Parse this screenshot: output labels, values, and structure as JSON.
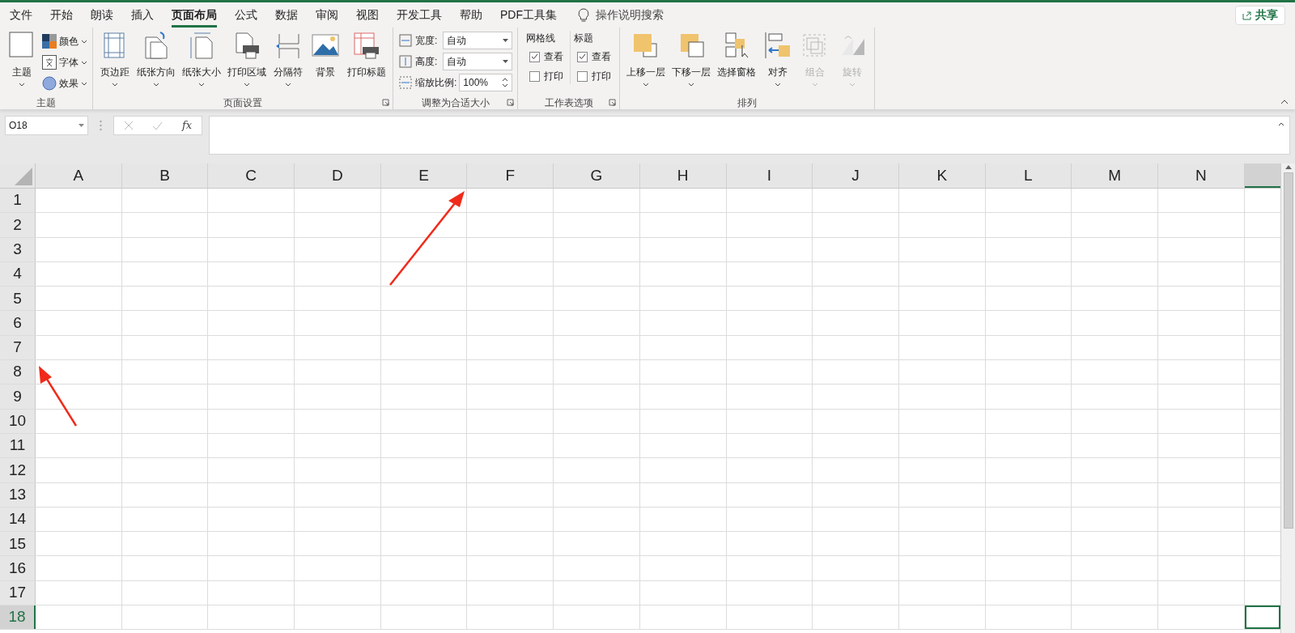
{
  "tabs": [
    {
      "label": "文件",
      "selected": false
    },
    {
      "label": "开始",
      "selected": false
    },
    {
      "label": "朗读",
      "selected": false
    },
    {
      "label": "插入",
      "selected": false
    },
    {
      "label": "页面布局",
      "selected": true
    },
    {
      "label": "公式",
      "selected": false
    },
    {
      "label": "数据",
      "selected": false
    },
    {
      "label": "审阅",
      "selected": false
    },
    {
      "label": "视图",
      "selected": false
    },
    {
      "label": "开发工具",
      "selected": false
    },
    {
      "label": "帮助",
      "selected": false
    },
    {
      "label": "PDF工具集",
      "selected": false
    }
  ],
  "tell_me": {
    "placeholder": "操作说明搜索"
  },
  "share_button": "共享",
  "ribbon_groups": [
    {
      "label": "主题",
      "launcher": false,
      "items": [
        {
          "kind": "large",
          "label": "主题",
          "dropdown": true,
          "disabled": false
        },
        {
          "kind": "stack",
          "entries": [
            "颜色",
            "字体",
            "效果"
          ]
        }
      ]
    },
    {
      "label": "页面设置",
      "launcher": true,
      "items": [
        {
          "kind": "large",
          "label": "页边距",
          "dropdown": true,
          "disabled": false
        },
        {
          "kind": "large",
          "label": "纸张方向",
          "dropdown": true,
          "disabled": false
        },
        {
          "kind": "large",
          "label": "纸张大小",
          "dropdown": true,
          "disabled": false
        },
        {
          "kind": "large",
          "label": "打印区域",
          "dropdown": true,
          "disabled": false
        },
        {
          "kind": "large",
          "label": "分隔符",
          "dropdown": true,
          "disabled": false
        },
        {
          "kind": "large",
          "label": "背景",
          "dropdown": false,
          "disabled": false
        },
        {
          "kind": "large",
          "label": "打印标题",
          "dropdown": false,
          "disabled": false
        }
      ]
    },
    {
      "label": "调整为合适大小",
      "launcher": true,
      "items": [
        {
          "kind": "fields",
          "entries": [
            {
              "label": "宽度:",
              "value": "自动",
              "kind": "dropdown"
            },
            {
              "label": "高度:",
              "value": "自动",
              "kind": "dropdown"
            },
            {
              "label": "缩放比例:",
              "value": "100%",
              "kind": "spinner"
            }
          ]
        }
      ]
    },
    {
      "label": "工作表选项",
      "launcher": true,
      "items": [
        {
          "kind": "checks",
          "title": "网格线",
          "entries": [
            {
              "label": "查看",
              "checked": true
            },
            {
              "label": "打印",
              "checked": false
            }
          ]
        },
        {
          "kind": "checks",
          "title": "标题",
          "entries": [
            {
              "label": "查看",
              "checked": true
            },
            {
              "label": "打印",
              "checked": false
            }
          ]
        }
      ]
    },
    {
      "label": "排列",
      "launcher": false,
      "items": [
        {
          "kind": "large",
          "label": "上移一层",
          "dropdown": true,
          "disabled": false
        },
        {
          "kind": "large",
          "label": "下移一层",
          "dropdown": true,
          "disabled": false
        },
        {
          "kind": "large",
          "label": "选择窗格",
          "dropdown": false,
          "disabled": false
        },
        {
          "kind": "large",
          "label": "对齐",
          "dropdown": true,
          "disabled": false
        },
        {
          "kind": "large",
          "label": "组合",
          "dropdown": true,
          "disabled": true
        },
        {
          "kind": "large",
          "label": "旋转",
          "dropdown": true,
          "disabled": true
        }
      ]
    }
  ],
  "formula_bar": {
    "name_box": "O18",
    "function_label": "fx"
  },
  "columns": [
    {
      "label": "A",
      "selected": false
    },
    {
      "label": "B",
      "selected": false
    },
    {
      "label": "C",
      "selected": false
    },
    {
      "label": "D",
      "selected": false
    },
    {
      "label": "E",
      "selected": false
    },
    {
      "label": "F",
      "selected": false
    },
    {
      "label": "G",
      "selected": false
    },
    {
      "label": "H",
      "selected": false
    },
    {
      "label": "I",
      "selected": false
    },
    {
      "label": "J",
      "selected": false
    },
    {
      "label": "K",
      "selected": false
    },
    {
      "label": "L",
      "selected": false
    },
    {
      "label": "M",
      "selected": false
    },
    {
      "label": "N",
      "selected": false
    }
  ],
  "partial_column_selected": true,
  "rows": [
    {
      "label": "1",
      "selected": false
    },
    {
      "label": "2",
      "selected": false
    },
    {
      "label": "3",
      "selected": false
    },
    {
      "label": "4",
      "selected": false
    },
    {
      "label": "5",
      "selected": false
    },
    {
      "label": "6",
      "selected": false
    },
    {
      "label": "7",
      "selected": false
    },
    {
      "label": "8",
      "selected": false
    },
    {
      "label": "9",
      "selected": false
    },
    {
      "label": "10",
      "selected": false
    },
    {
      "label": "11",
      "selected": false
    },
    {
      "label": "12",
      "selected": false
    },
    {
      "label": "13",
      "selected": false
    },
    {
      "label": "14",
      "selected": false
    },
    {
      "label": "15",
      "selected": false
    },
    {
      "label": "16",
      "selected": false
    },
    {
      "label": "17",
      "selected": false
    },
    {
      "label": "18",
      "selected": true
    }
  ]
}
